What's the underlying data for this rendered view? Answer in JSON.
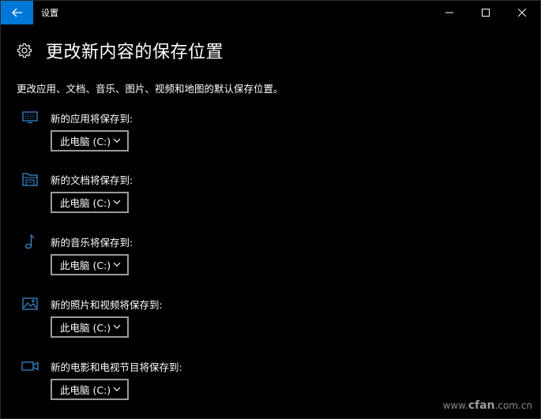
{
  "window": {
    "title": "设置"
  },
  "header": {
    "title": "更改新内容的保存位置"
  },
  "description": "更改应用、文档、音乐、图片、视频和地图的默认保存位置。",
  "sections": [
    {
      "label": "新的应用将保存到:",
      "value": "此电脑 (C:)",
      "icon": "monitor-icon"
    },
    {
      "label": "新的文档将保存到:",
      "value": "此电脑 (C:)",
      "icon": "folder-icon"
    },
    {
      "label": "新的音乐将保存到:",
      "value": "此电脑 (C:)",
      "icon": "music-note-icon"
    },
    {
      "label": "新的照片和视频将保存到:",
      "value": "此电脑 (C:)",
      "icon": "picture-icon"
    },
    {
      "label": "新的电影和电视节目将保存到:",
      "value": "此电脑 (C:)",
      "icon": "video-camera-icon"
    }
  ],
  "watermark": {
    "prefix": "www.",
    "brand": "cfan",
    "suffix": ".com.cn"
  },
  "colors": {
    "accent": "#0078d7",
    "background": "#000000",
    "text": "#ffffff",
    "dropdown_border": "#9a9a9a"
  }
}
